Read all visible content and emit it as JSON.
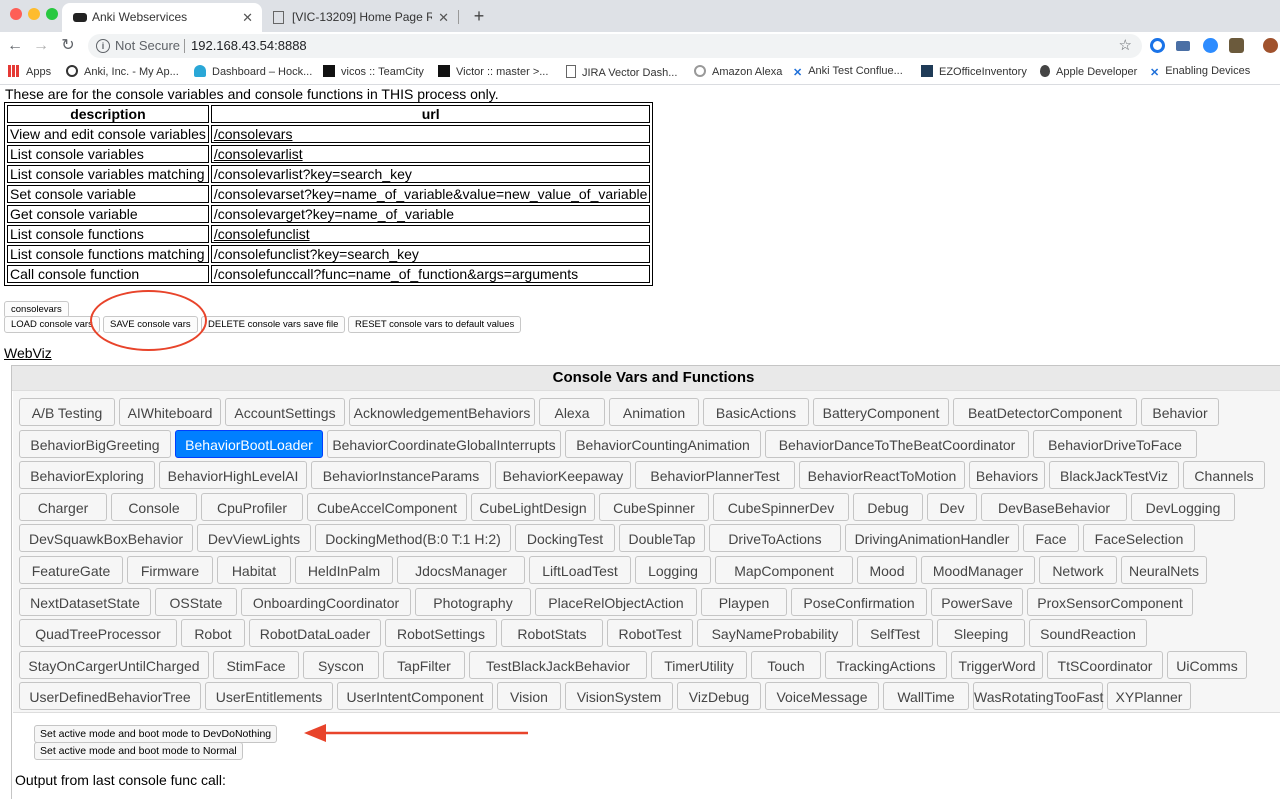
{
  "browser": {
    "tabs": [
      {
        "title": "Anki Webservices",
        "active": true
      },
      {
        "title": "[VIC-13209] Home Page Redu",
        "active": false
      }
    ],
    "address": {
      "security": "Not Secure",
      "url": "192.168.43.54:8888"
    },
    "bookmarks": [
      {
        "label": "Apps",
        "icon": "apps-grid-icon"
      },
      {
        "label": "Anki, Inc. - My Ap...",
        "icon": "anki-icon"
      },
      {
        "label": "Dashboard – Hock...",
        "icon": "hockeyapp-icon"
      },
      {
        "label": "vicos :: TeamCity",
        "icon": "teamcity-icon"
      },
      {
        "label": "Victor :: master >...",
        "icon": "teamcity-icon"
      },
      {
        "label": "JIRA Vector Dash...",
        "icon": "page-icon"
      },
      {
        "label": "Amazon Alexa",
        "icon": "alexa-icon"
      },
      {
        "label": "Anki Test Conflue...",
        "icon": "confluence-icon"
      },
      {
        "label": "EZOfficeInventory",
        "icon": "ez-icon"
      },
      {
        "label": "Apple Developer",
        "icon": "apple-icon"
      },
      {
        "label": "Enabling Devices",
        "icon": "confluence-icon"
      }
    ]
  },
  "page": {
    "intro": "These are for the console variables and console functions in THIS process only.",
    "table": {
      "headers": [
        "description",
        "url"
      ],
      "rows": [
        {
          "description": "View and edit console variables",
          "url": "/consolevars",
          "link": true
        },
        {
          "description": "List console variables",
          "url": "/consolevarlist",
          "link": true
        },
        {
          "description": "List console variables matching",
          "url": "/consolevarlist?key=search_key",
          "link": false
        },
        {
          "description": "Set console variable",
          "url": "/consolevarset?key=name_of_variable&value=new_value_of_variable",
          "link": false
        },
        {
          "description": "Get console variable",
          "url": "/consolevarget?key=name_of_variable",
          "link": false
        },
        {
          "description": "List console functions",
          "url": "/consolefunclist",
          "link": true
        },
        {
          "description": "List console functions matching",
          "url": "/consolefunclist?key=search_key",
          "link": false
        },
        {
          "description": "Call console function",
          "url": "/consolefunccall?func=name_of_function&args=arguments",
          "link": false
        }
      ]
    },
    "buttons": {
      "consolevars": "consolevars",
      "load": "LOAD console vars",
      "save": "SAVE console vars",
      "delete": "DELETE console vars save file",
      "reset": "RESET console vars to default values"
    },
    "webviz": "WebViz",
    "panel_title": "Console Vars and Functions",
    "selected_tab": "BehaviorBootLoader",
    "tab_rows": [
      [
        "A/B Testing",
        "AIWhiteboard",
        "AccountSettings",
        "AcknowledgementBehaviors",
        "Alexa",
        "Animation",
        "BasicActions",
        "BatteryComponent",
        "BeatDetectorComponent",
        "Behavior"
      ],
      [
        "BehaviorBigGreeting",
        "BehaviorBootLoader",
        "BehaviorCoordinateGlobalInterrupts",
        "BehaviorCountingAnimation",
        "BehaviorDanceToTheBeatCoordinator",
        "BehaviorDriveToFace"
      ],
      [
        "BehaviorExploring",
        "BehaviorHighLevelAI",
        "BehaviorInstanceParams",
        "BehaviorKeepaway",
        "BehaviorPlannerTest",
        "BehaviorReactToMotion",
        "Behaviors",
        "BlackJackTestViz",
        "Channels"
      ],
      [
        "Charger",
        "Console",
        "CpuProfiler",
        "CubeAccelComponent",
        "CubeLightDesign",
        "CubeSpinner",
        "CubeSpinnerDev",
        "Debug",
        "Dev",
        "DevBaseBehavior",
        "DevLogging"
      ],
      [
        "DevSquawkBoxBehavior",
        "DevViewLights",
        "DockingMethod(B:0 T:1 H:2)",
        "DockingTest",
        "DoubleTap",
        "DriveToActions",
        "DrivingAnimationHandler",
        "Face",
        "FaceSelection"
      ],
      [
        "FeatureGate",
        "Firmware",
        "Habitat",
        "HeldInPalm",
        "JdocsManager",
        "LiftLoadTest",
        "Logging",
        "MapComponent",
        "Mood",
        "MoodManager",
        "Network",
        "NeuralNets"
      ],
      [
        "NextDatasetState",
        "OSState",
        "OnboardingCoordinator",
        "Photography",
        "PlaceRelObjectAction",
        "Playpen",
        "PoseConfirmation",
        "PowerSave",
        "ProxSensorComponent"
      ],
      [
        "QuadTreeProcessor",
        "Robot",
        "RobotDataLoader",
        "RobotSettings",
        "RobotStats",
        "RobotTest",
        "SayNameProbability",
        "SelfTest",
        "Sleeping",
        "SoundReaction"
      ],
      [
        "StayOnCargerUntilCharged",
        "StimFace",
        "Syscon",
        "TapFilter",
        "TestBlackJackBehavior",
        "TimerUtility",
        "Touch",
        "TrackingActions",
        "TriggerWord",
        "TtSCoordinator",
        "UiComms"
      ],
      [
        "UserDefinedBehaviorTree",
        "UserEntitlements",
        "UserIntentComponent",
        "Vision",
        "VisionSystem",
        "VizDebug",
        "VoiceMessage",
        "WallTime",
        "WasRotatingTooFast",
        "XYPlanner"
      ]
    ],
    "mode_buttons": [
      "Set active mode and boot mode to DevDoNothing",
      "Set active mode and boot mode to Normal"
    ],
    "output_label": "Output from last console func call:"
  },
  "colors": {
    "annotation": "#e8442b",
    "active_tab": "#007fff"
  }
}
